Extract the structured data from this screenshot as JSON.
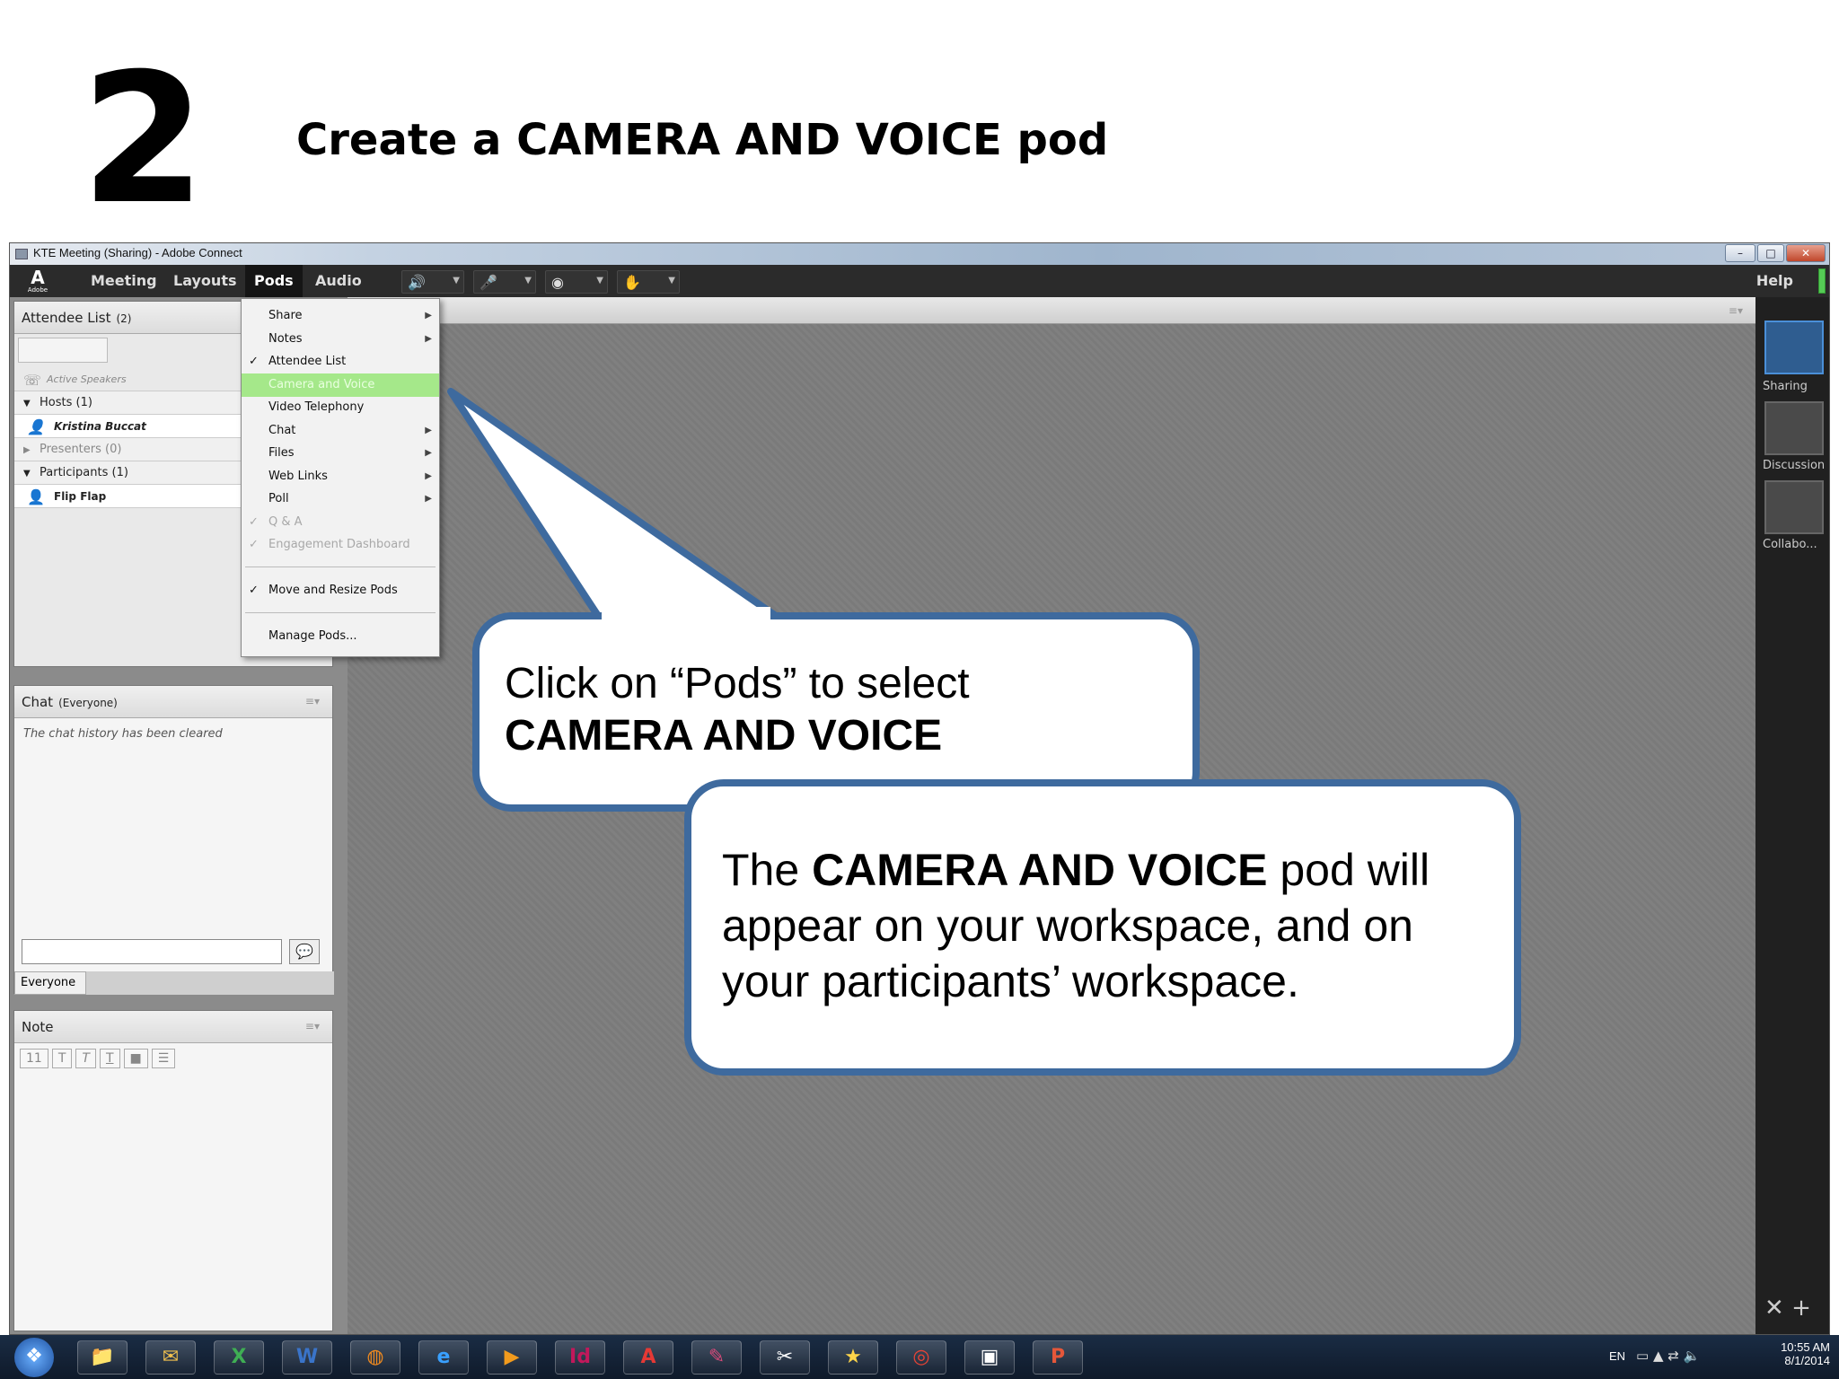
{
  "slide": {
    "step_number": "2",
    "heading": "Create a CAMERA AND VOICE pod"
  },
  "window": {
    "title": "KTE Meeting (Sharing) - Adobe Connect",
    "controls": [
      "–",
      "□",
      "✕"
    ]
  },
  "menubar": {
    "logo_text": "Adobe",
    "items": [
      "Meeting",
      "Layouts",
      "Pods",
      "Audio"
    ],
    "help": "Help",
    "tools": [
      "speaker-icon",
      "microphone-icon",
      "webcam-icon",
      "status-icon"
    ]
  },
  "attendee_pod": {
    "title": "Attendee List",
    "count": "(2)",
    "active_speakers": "Active Speakers",
    "hosts_label": "Hosts (1)",
    "host_user": "Kristina Buccat",
    "presenters_label": "Presenters (0)",
    "participants_label": "Participants (1)",
    "participant_user": "Flip Flap"
  },
  "chat_pod": {
    "title": "Chat",
    "scope": "(Everyone)",
    "message": "The chat history has been cleared",
    "recipient": "Everyone"
  },
  "note_pod": {
    "title": "Note",
    "font_size": "11"
  },
  "pods_menu": {
    "items": [
      {
        "label": "Share",
        "checked": false,
        "submenu": true,
        "state": "normal"
      },
      {
        "label": "Notes",
        "checked": false,
        "submenu": true,
        "state": "normal"
      },
      {
        "label": "Attendee List",
        "checked": true,
        "submenu": false,
        "state": "normal"
      },
      {
        "label": "Camera and Voice",
        "checked": false,
        "submenu": false,
        "state": "highlighted"
      },
      {
        "label": "Video Telephony",
        "checked": false,
        "submenu": false,
        "state": "normal"
      },
      {
        "label": "Chat",
        "checked": false,
        "submenu": true,
        "state": "normal"
      },
      {
        "label": "Files",
        "checked": false,
        "submenu": true,
        "state": "normal"
      },
      {
        "label": "Web Links",
        "checked": false,
        "submenu": true,
        "state": "normal"
      },
      {
        "label": "Poll",
        "checked": false,
        "submenu": true,
        "state": "normal"
      },
      {
        "label": "Q & A",
        "checked": true,
        "submenu": false,
        "state": "disabled"
      },
      {
        "label": "Engagement Dashboard",
        "checked": true,
        "submenu": false,
        "state": "disabled"
      },
      {
        "label": "Move and Resize Pods",
        "checked": true,
        "submenu": false,
        "state": "normal"
      },
      {
        "label": "Manage Pods...",
        "checked": false,
        "submenu": false,
        "state": "normal"
      }
    ]
  },
  "layouts_panel": {
    "items": [
      "Sharing",
      "Discussion",
      "Collabo..."
    ],
    "selected": "Sharing"
  },
  "callout1": {
    "line1": "Click on “Pods” to select",
    "line2": "CAMERA AND VOICE"
  },
  "callout2": {
    "prefix": "The ",
    "bold": "CAMERA AND VOICE",
    "suffix": " pod will appear on your workspace, and on your participants’ workspace."
  },
  "taskbar": {
    "apps": [
      "file-explorer-icon",
      "outlook-icon",
      "excel-icon",
      "word-icon",
      "firefox-icon",
      "internet-explorer-icon",
      "media-player-icon",
      "indesign-icon",
      "acrobat-icon",
      "adobe-connect-icon",
      "snipping-tool-icon",
      "star-app-icon",
      "chrome-icon",
      "photo-viewer-icon",
      "presentation-icon"
    ],
    "language": "EN",
    "time": "10:55 AM",
    "date": "8/1/2014"
  },
  "colors": {
    "callout_border": "#3e6a9e",
    "menu_highlight": "#a5e88a",
    "menubar_bg": "#2b2b2b",
    "stage_bg": "#7d7d7d"
  }
}
